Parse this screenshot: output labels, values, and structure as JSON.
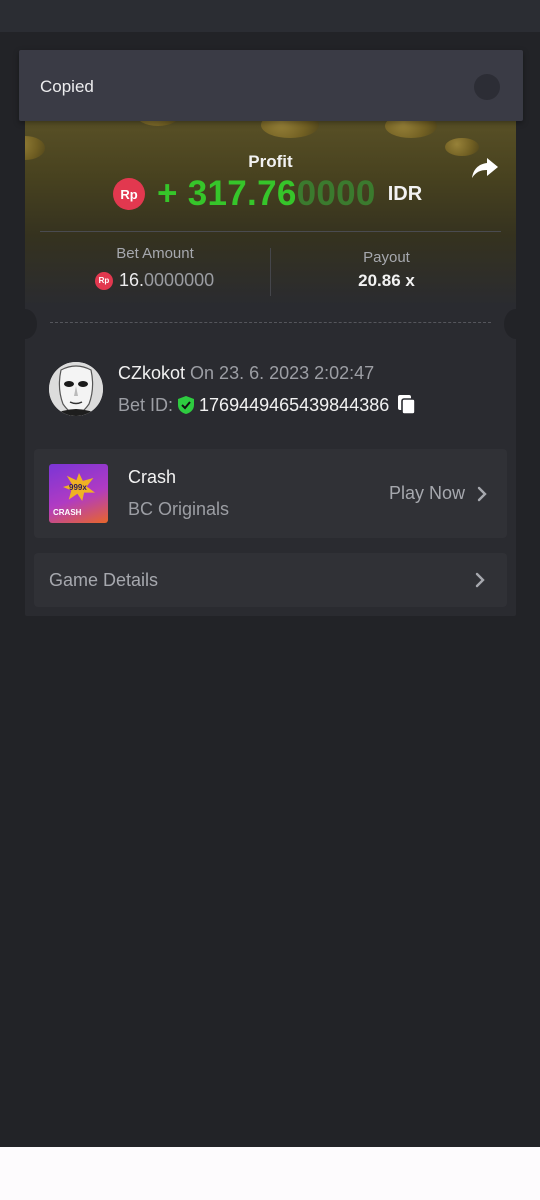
{
  "toast": {
    "message": "Copied"
  },
  "bet_card": {
    "profit_label": "Profit",
    "currency_badge": "Rp",
    "profit_value_bright": "+ 317.76",
    "profit_value_dim": "0000",
    "profit_currency": "IDR",
    "bet_amount_label": "Bet Amount",
    "bet_amount_main": "16.",
    "bet_amount_dim": "0000000",
    "payout_label": "Payout",
    "payout_value": "20.86 x"
  },
  "user": {
    "name": "CZkokot",
    "date": "On 23. 6. 2023 2:02:47",
    "bet_id_label": "Bet ID:",
    "bet_id": "1769449465439844386"
  },
  "game": {
    "name": "Crash",
    "provider": "BC Originals",
    "play_label": "Play Now",
    "thumb_badge": "999x",
    "thumb_label": "CRASH"
  },
  "details": {
    "label": "Game Details"
  },
  "colors": {
    "profit_green": "#36c52a",
    "currency_red": "#e2384f",
    "verified_green": "#2ecc40",
    "background": "#222327"
  },
  "icons": [
    "share-icon",
    "verified-shield-icon",
    "copy-icon",
    "chevron-right-icon"
  ]
}
